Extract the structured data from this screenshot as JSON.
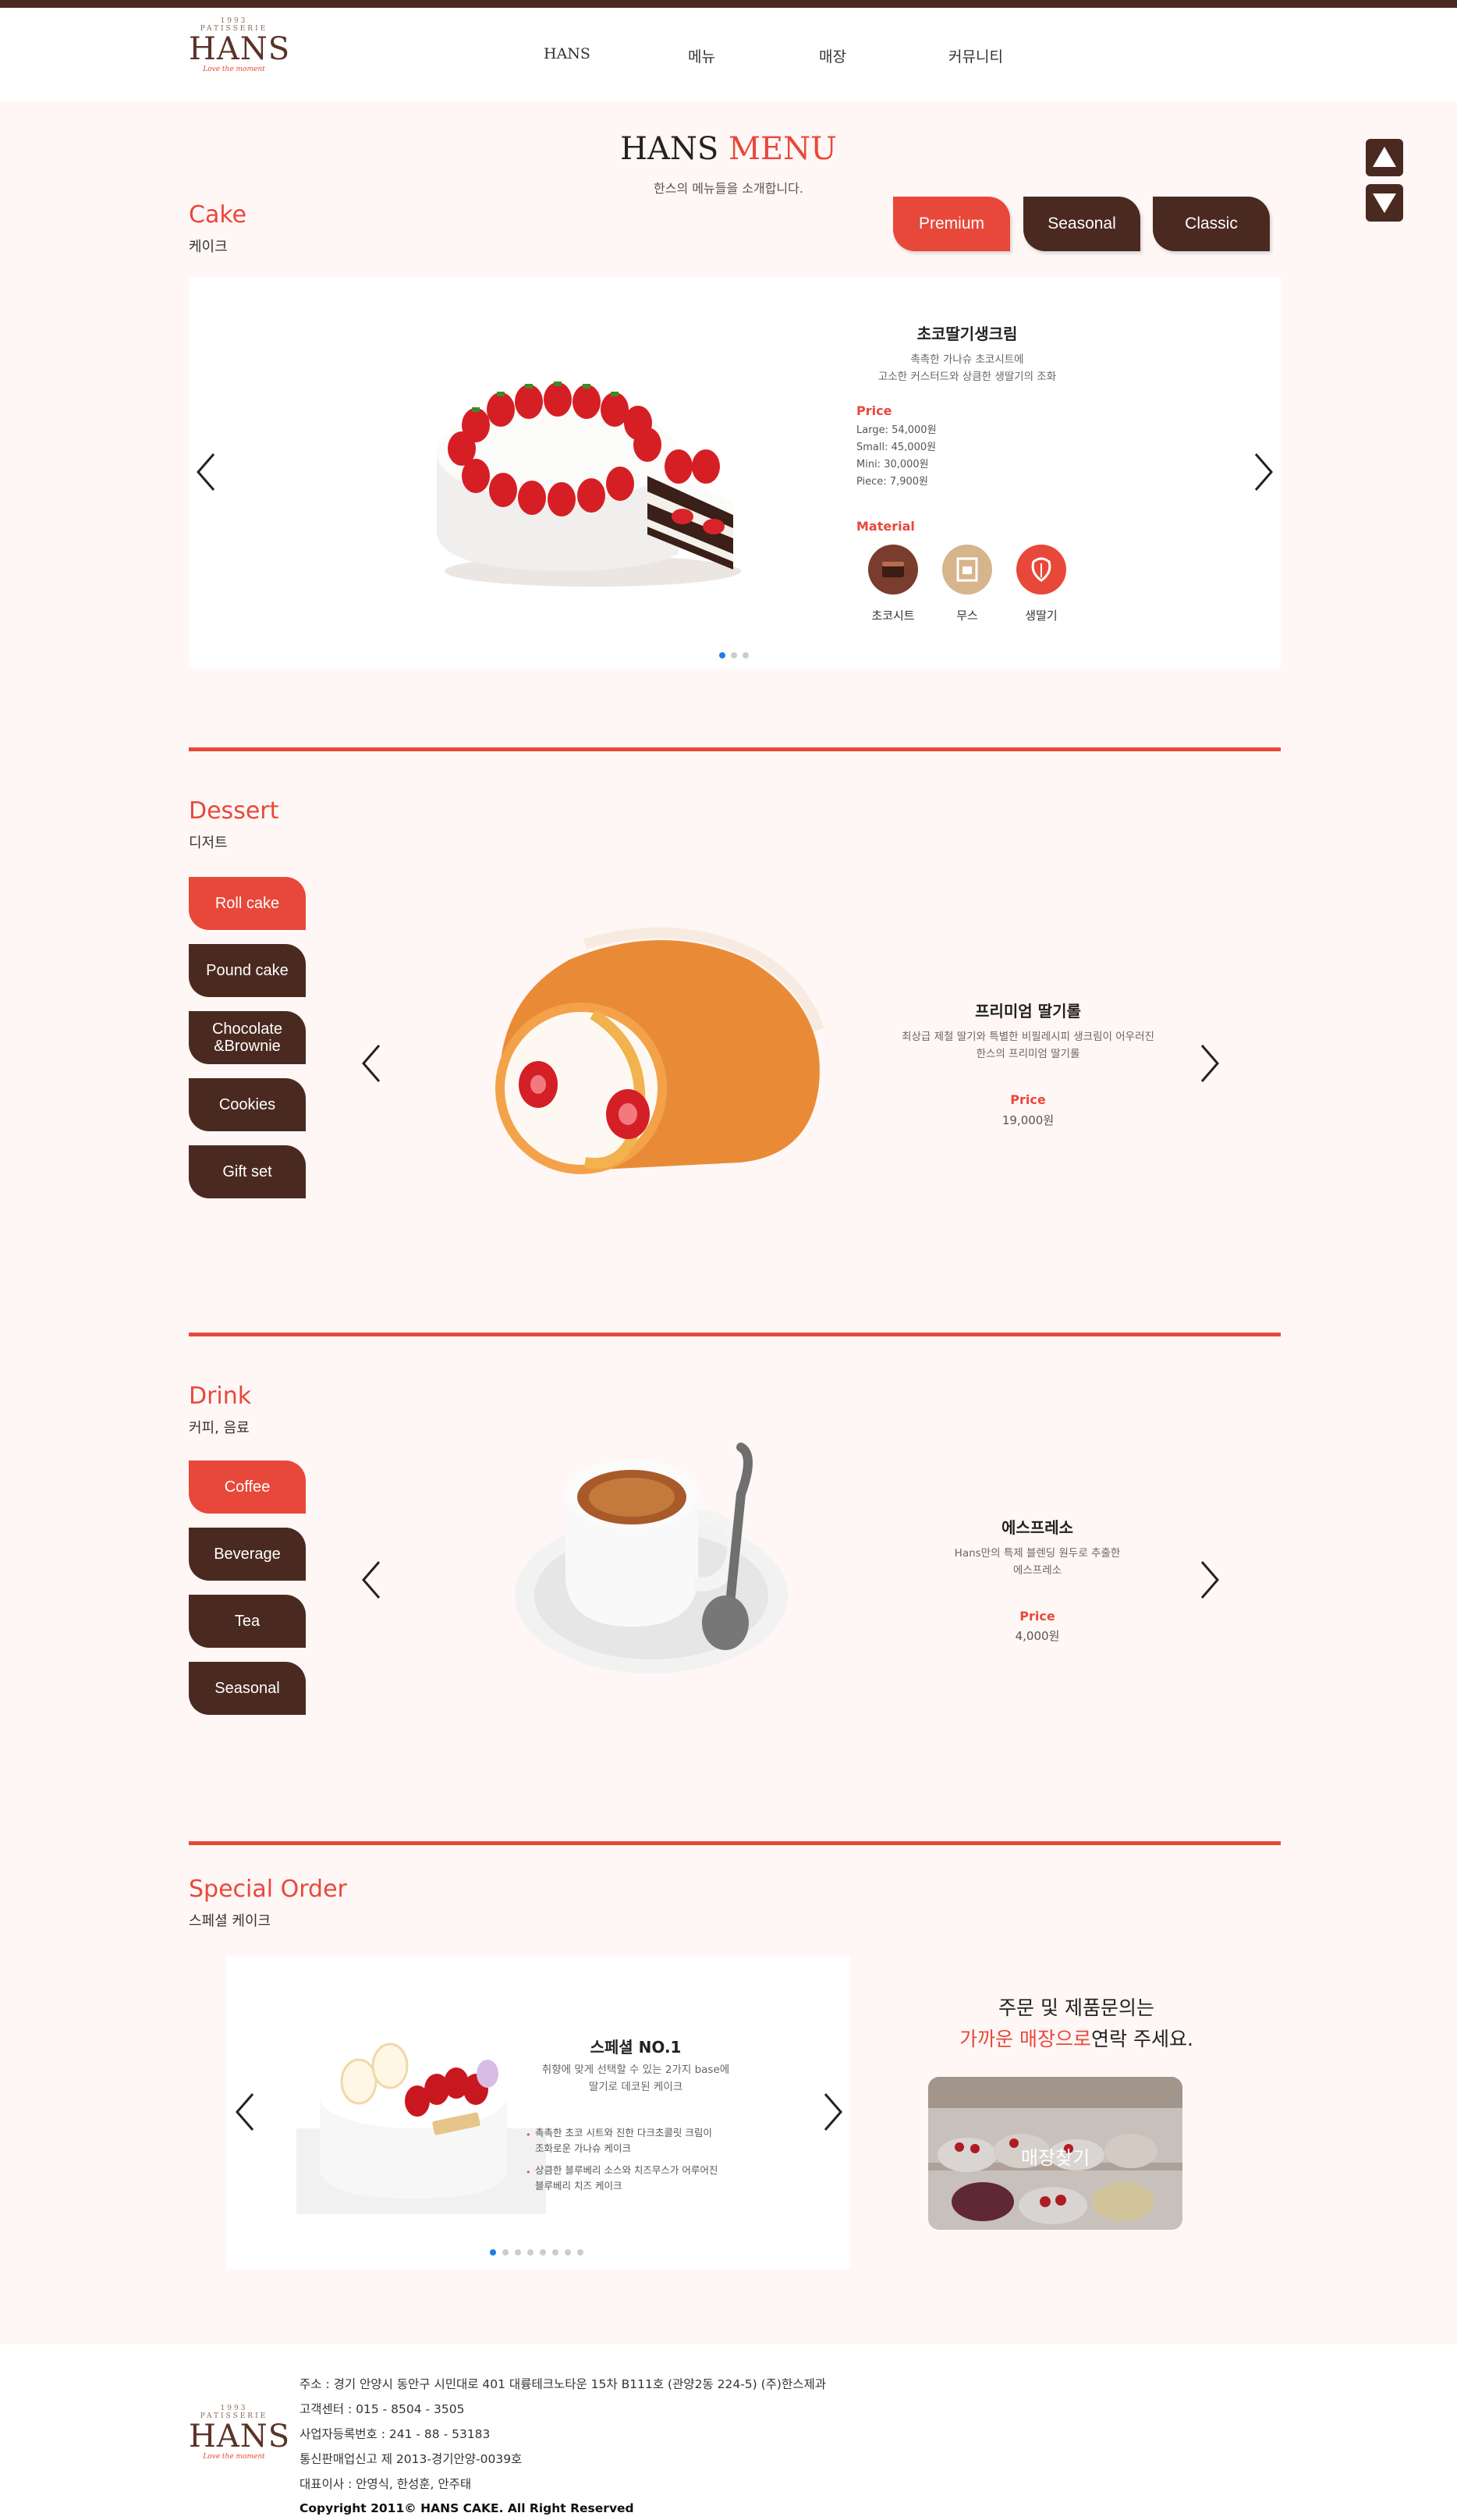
{
  "header": {
    "logo_sub": "1993 PATISSERIE",
    "logo_text": "HANS",
    "logo_tagline": "Love the moment",
    "nav": [
      "HANS",
      "메뉴",
      "매장",
      "커뮤니티"
    ]
  },
  "page": {
    "title_a": "HANS",
    "title_b": "MENU",
    "subtitle": "한스의 메뉴들을 소개합니다."
  },
  "cake": {
    "title": "Cake",
    "subtitle": "케이크",
    "tabs": [
      "Premium",
      "Seasonal",
      "Classic"
    ],
    "active_tab": 0,
    "product": {
      "name": "초코딸기생크림",
      "desc1": "촉촉한 가나슈 초코시트에",
      "desc2": "고소한 커스터드와 상큼한 생딸기의 조화",
      "price_label": "Price",
      "prices": [
        "Large: 54,000원",
        "Small: 45,000원",
        "Mini: 30,000원",
        "Piece: 7,900원"
      ],
      "material_label": "Material",
      "materials": [
        {
          "name": "초코시트",
          "color": "#7a3c2c",
          "icon": "choco-sheet-icon"
        },
        {
          "name": "무스",
          "color": "#d6b48c",
          "icon": "mousse-icon"
        },
        {
          "name": "생딸기",
          "color": "#e8483a",
          "icon": "strawberry-icon"
        }
      ]
    },
    "dots": 3,
    "active_dot": 0
  },
  "dessert": {
    "title": "Dessert",
    "subtitle": "디저트",
    "items": [
      "Roll cake",
      "Pound cake",
      "Chocolate\n&Brownie",
      "Cookies",
      "Gift set"
    ],
    "active": 0,
    "product": {
      "name": "프리미엄 딸기롤",
      "desc1": "최상급 제철 딸기와 특별한 비필레시피 생크림이 어우러진",
      "desc2": "한스의 프리미엄 딸기롤",
      "price_label": "Price",
      "price": "19,000원"
    }
  },
  "drink": {
    "title": "Drink",
    "subtitle": "커피, 음료",
    "items": [
      "Coffee",
      "Beverage",
      "Tea",
      "Seasonal"
    ],
    "active": 0,
    "product": {
      "name": "에스프레소",
      "desc1": "Hans만의 특제 블렌딩 원두로 추출한",
      "desc2": "에스프레소",
      "price_label": "Price",
      "price": "4,000원"
    }
  },
  "special": {
    "title": "Special Order",
    "subtitle": "스페셜 케이크",
    "product": {
      "name": "스페셜 NO.1",
      "desc1": "취향에 맞게 선택할 수 있는 2가지 base에",
      "desc2": "딸기로 데코된 케이크",
      "bullet1a": "촉촉한 초코 시트와 진한 다크초콜릿 크림이",
      "bullet1b": "조화로운 가나슈 케이크",
      "bullet2a": "상큼한 블루베리 소스와 치즈무스가 어루어진",
      "bullet2b": "블루베리 치즈 케이크"
    },
    "dots": 8,
    "active_dot": 0,
    "cta_line1": "주문 및 제품문의는",
    "cta_line2_red": "가까운 매장으로",
    "cta_line2_rest": "연락 주세요.",
    "store_button": "매장찾기"
  },
  "footer": {
    "address": "주소 : 경기 안양시 동안구 시민대로 401 대륭테크노타운 15차 B111호 (관양2동 224-5) (주)한스제과",
    "phone": "고객센터 : 015 - 8504 - 3505",
    "biz_no": "사업자등록번호 : 241 - 88 - 53183",
    "mail_order": "통신판매업신고 제 2013-경기안양-0039호",
    "ceo": "대표이사 : 안영식, 한성훈, 안주태",
    "copyright": "Copyright 2011© HANS CAKE. All Right Reserved"
  }
}
